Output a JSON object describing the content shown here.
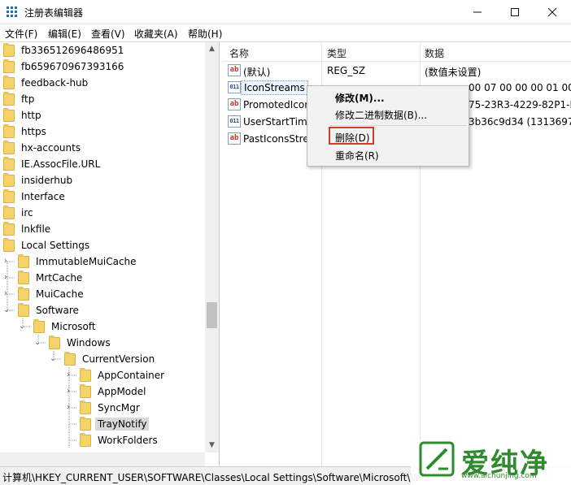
{
  "window": {
    "title": "注册表编辑器",
    "minimize_icon": "minimize-icon",
    "maximize_icon": "maximize-icon",
    "close_icon": "close-icon"
  },
  "menubar": [
    "文件(F)",
    "编辑(E)",
    "查看(V)",
    "收藏夹(A)",
    "帮助(H)"
  ],
  "tree": {
    "items": [
      {
        "label": "fb336512696486951",
        "level": 0
      },
      {
        "label": "fb659670967393166",
        "level": 0
      },
      {
        "label": "feedback-hub",
        "level": 0
      },
      {
        "label": "ftp",
        "level": 0
      },
      {
        "label": "http",
        "level": 0
      },
      {
        "label": "https",
        "level": 0
      },
      {
        "label": "hx-accounts",
        "level": 0
      },
      {
        "label": "IE.AssocFile.URL",
        "level": 0
      },
      {
        "label": "insiderhub",
        "level": 0
      },
      {
        "label": "Interface",
        "level": 0
      },
      {
        "label": "irc",
        "level": 0
      },
      {
        "label": "lnkfile",
        "level": 0
      },
      {
        "label": "Local Settings",
        "level": 0
      },
      {
        "label": "ImmutableMuiCache",
        "level": 1
      },
      {
        "label": "MrtCache",
        "level": 1
      },
      {
        "label": "MuiCache",
        "level": 1
      },
      {
        "label": "Software",
        "level": 1
      },
      {
        "label": "Microsoft",
        "level": 2
      },
      {
        "label": "Windows",
        "level": 3
      },
      {
        "label": "CurrentVersion",
        "level": 4
      },
      {
        "label": "AppContainer",
        "level": 5
      },
      {
        "label": "AppModel",
        "level": 5
      },
      {
        "label": "SyncMgr",
        "level": 5
      },
      {
        "label": "TrayNotify",
        "level": 5
      },
      {
        "label": "WorkFolders",
        "level": 5
      }
    ]
  },
  "list": {
    "columns": [
      "名称",
      "类型",
      "数据"
    ],
    "rows": [
      {
        "name": "(默认)",
        "type": "REG_SZ",
        "data": "(数值未设置)",
        "icon": "string-value-icon"
      },
      {
        "name": "IconStreams",
        "type": "",
        "data": "00 07 00 00 00 01 00",
        "icon": "binary-value-icon"
      },
      {
        "name": "PromotedIcon",
        "type": "",
        "data": "75-23R3-4229-82P1-R",
        "icon": "string-value-icon"
      },
      {
        "name": "UserStartTime",
        "type": "",
        "data": "3b36c9d34 (1313697",
        "icon": "binary-value-icon"
      },
      {
        "name": "PastIconsStre",
        "type": "",
        "data": "",
        "icon": "string-value-icon"
      }
    ]
  },
  "context_menu": {
    "items": [
      "修改(M)...",
      "修改二进制数据(B)...",
      "删除(D)",
      "重命名(R)"
    ]
  },
  "status": {
    "path": "计算机\\HKEY_CURRENT_USER\\SOFTWARE\\Classes\\Local Settings\\Software\\Microsoft\\W"
  },
  "watermark": {
    "brand": "爱纯净",
    "url": "www.aichunjing.com"
  },
  "colors": {
    "accent": "#1b6ec2",
    "highlight_box": "#d43b2e",
    "folder": "#f4d36a",
    "watermark": "#2e8b2e"
  }
}
